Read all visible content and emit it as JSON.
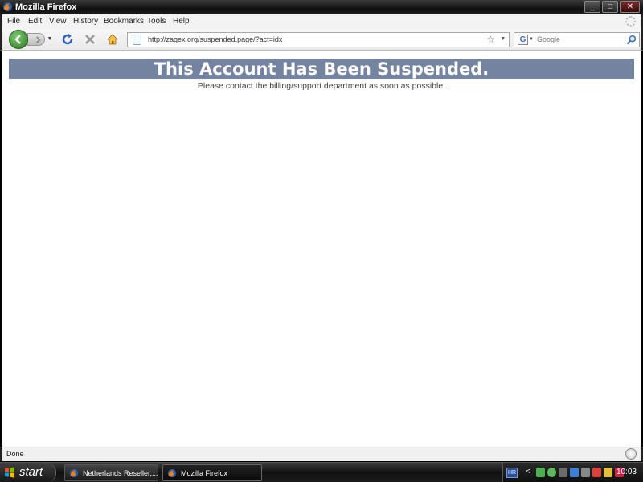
{
  "window": {
    "title": "Mozilla Firefox"
  },
  "menu": [
    "File",
    "Edit",
    "View",
    "History",
    "Bookmarks",
    "Tools",
    "Help"
  ],
  "navigation": {
    "url": "http://zagex.org/suspended.page/?act=idx",
    "search_placeholder": "Google"
  },
  "page": {
    "heading": "This Account Has Been Suspended.",
    "message": "Please contact the billing/support department as soon as possible."
  },
  "status": {
    "text": "Done"
  },
  "taskbar": {
    "start_label": "start",
    "tasks": [
      "Netherlands Reseller,...",
      "Mozilla Firefox"
    ],
    "language": "HR",
    "clock": "10:03"
  },
  "colors": {
    "banner": "#7383a0",
    "back_button": "#3f8f32"
  },
  "icons": [
    "firefox-icon",
    "back-arrow-icon",
    "forward-arrow-icon",
    "reload-icon",
    "stop-icon",
    "home-icon",
    "page-icon",
    "bookmark-star-icon",
    "google-icon",
    "search-magnifier-icon",
    "windows-flag-icon"
  ]
}
